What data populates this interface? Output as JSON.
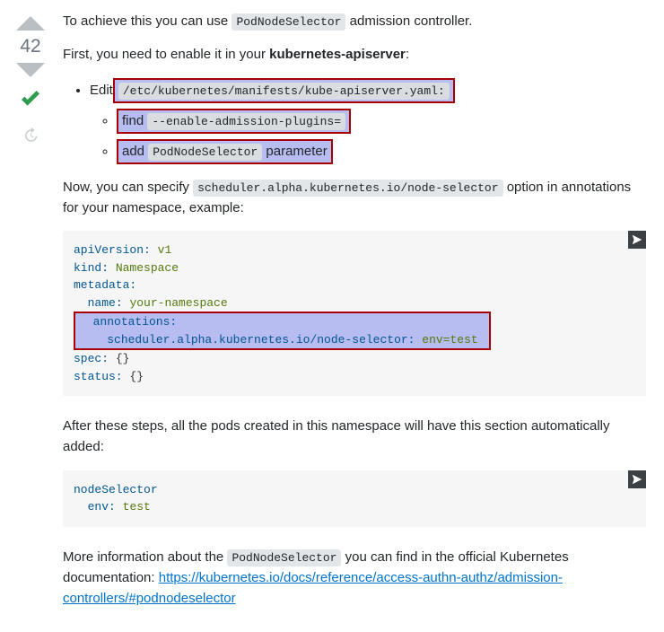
{
  "votes": {
    "score": "42"
  },
  "p1a": "To achieve this you can use ",
  "p1code": "PodNodeSelector",
  "p1b": " admission controller.",
  "p2a": "First, you need to enable it in your ",
  "p2bold": "kubernetes-apiserver",
  "p2b": ":",
  "bullet1a": "Edit",
  "bullet1code": "/etc/kubernetes/manifests/kube-apiserver.yaml:",
  "bullet1_1a": "find ",
  "bullet1_1code": "--enable-admission-plugins=",
  "bullet1_2a": "add ",
  "bullet1_2code": "PodNodeSelector",
  "bullet1_2b": " parameter",
  "p3a": "Now, you can specify ",
  "p3code": "scheduler.alpha.kubernetes.io/node-selector",
  "p3b": " option in annotations for your namespace, example:",
  "p4": "After these steps, all the pods created in this namespace will have this section automatically added:",
  "p5a": "More information about the ",
  "p5code": "PodNodeSelector",
  "p5b": " you can find in the official Kubernetes documentation: ",
  "p5link": "https://kubernetes.io/docs/reference/access-authn-authz/admission-controllers/#podnodeselector",
  "code1": {
    "l1k": "apiVersion:",
    "l1v": "v1",
    "l2k": "kind:",
    "l2v": "Namespace",
    "l3k": "metadata:",
    "l4k": "name:",
    "l4v": "your-namespace",
    "l5k": "annotations:",
    "l6k": "scheduler.alpha.kubernetes.io/node-selector:",
    "l6v": "env=test",
    "l7k": "spec:",
    "l7v": "{}",
    "l8k": "status:",
    "l8v": "{}"
  },
  "code2": {
    "l1k": "nodeSelector",
    "l2k": "env:",
    "l2v": "test"
  },
  "chart_data": null
}
